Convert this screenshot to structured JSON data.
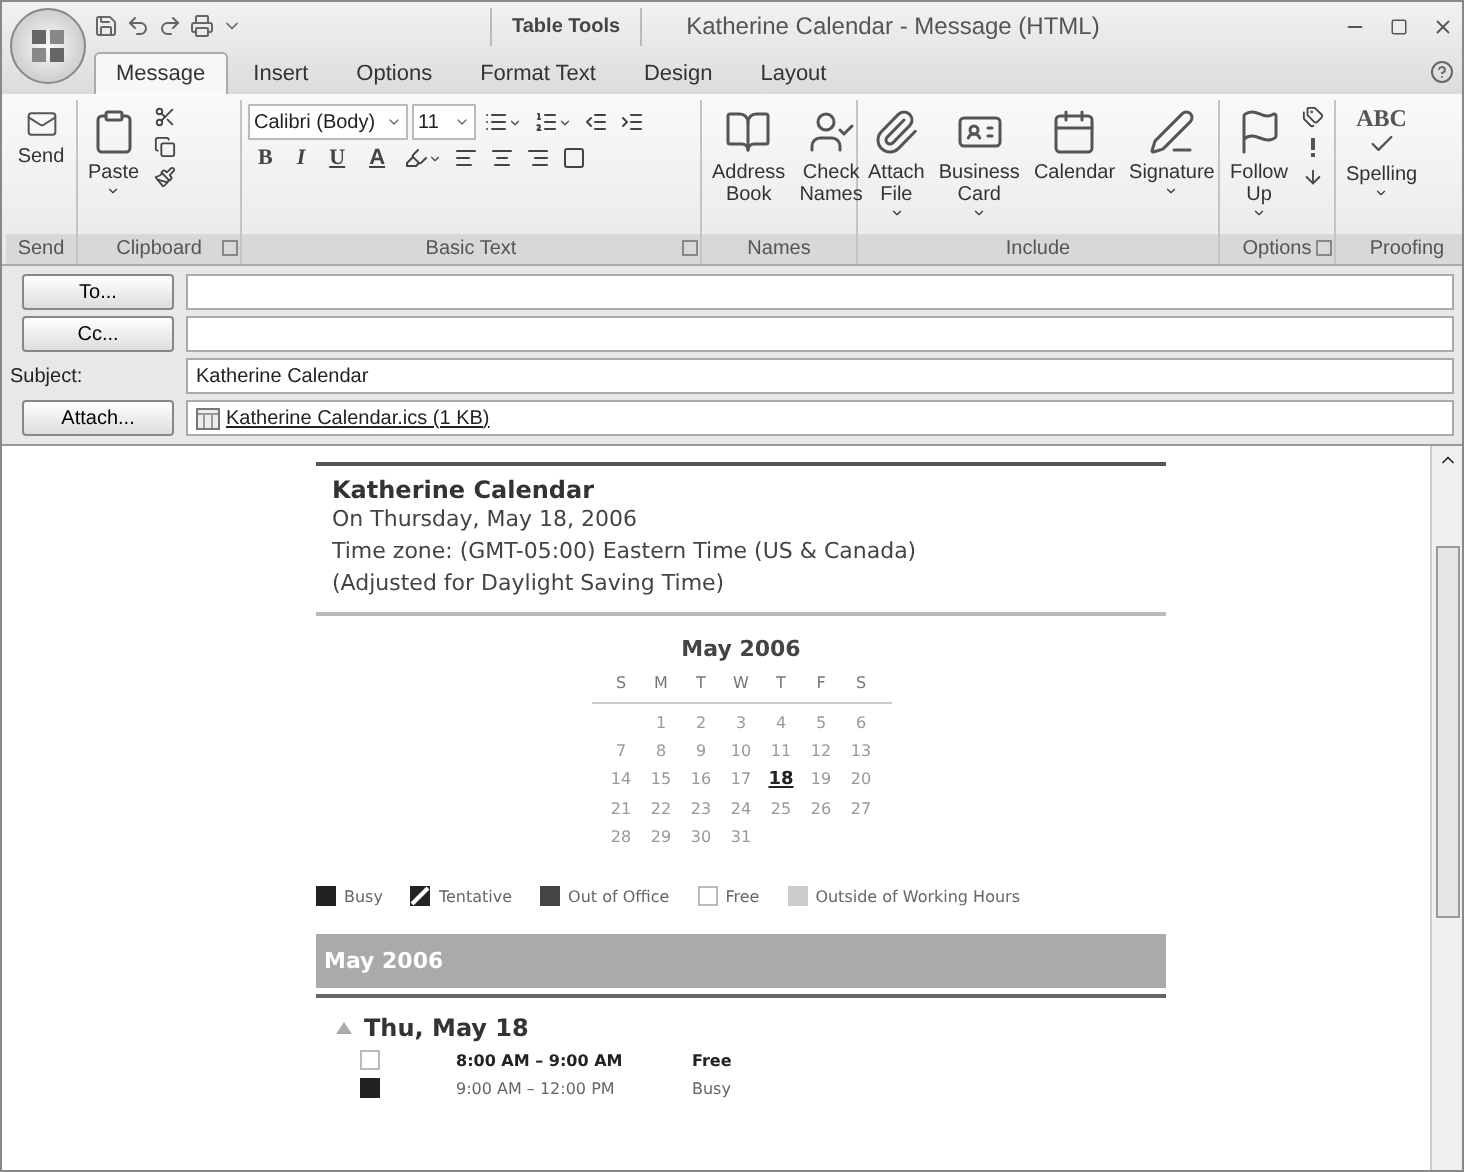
{
  "window": {
    "title": "Katherine Calendar - Message (HTML)",
    "contextual_label": "Table Tools"
  },
  "tabs": [
    {
      "label": "Message",
      "selected": true
    },
    {
      "label": "Insert",
      "selected": false
    },
    {
      "label": "Options",
      "selected": false
    },
    {
      "label": "Format Text",
      "selected": false
    },
    {
      "label": "Design",
      "selected": false
    },
    {
      "label": "Layout",
      "selected": false
    }
  ],
  "ribbon": {
    "groups": [
      {
        "kind": "send",
        "label": "Send",
        "launcher": false,
        "buttons": [
          {
            "label": "Send",
            "dropdown": false
          }
        ]
      },
      {
        "kind": "clipboard",
        "label": "Clipboard",
        "launcher": true,
        "buttons": [
          {
            "label": "Paste",
            "dropdown": true
          }
        ]
      },
      {
        "kind": "basic_text",
        "label": "Basic Text",
        "launcher": true,
        "font": "Calibri (Body)",
        "size": "11",
        "format_keys": [
          "B",
          "I",
          "U"
        ],
        "color_key": "A"
      },
      {
        "kind": "names",
        "label": "Names",
        "launcher": false,
        "buttons": [
          {
            "label": "Address Book",
            "dropdown": false
          },
          {
            "label": "Check Names",
            "dropdown": false
          }
        ]
      },
      {
        "kind": "include",
        "label": "Include",
        "launcher": false,
        "buttons": [
          {
            "label": "Attach File",
            "dropdown": true
          },
          {
            "label": "Business Card",
            "dropdown": true
          },
          {
            "label": "Calendar",
            "dropdown": false
          },
          {
            "label": "Signature",
            "dropdown": true
          }
        ]
      },
      {
        "kind": "options",
        "label": "Options",
        "launcher": true,
        "buttons": [
          {
            "label": "Follow Up",
            "dropdown": true
          }
        ]
      },
      {
        "kind": "proofing",
        "label": "Proofing",
        "launcher": false,
        "glyph": "ABC",
        "buttons": [
          {
            "label": "Spelling",
            "dropdown": true
          }
        ]
      }
    ]
  },
  "form": {
    "to": {
      "label": "To..."
    },
    "cc": {
      "label": "Cc..."
    },
    "subject": {
      "label": "Subject:",
      "value": "Katherine Calendar"
    },
    "attach": {
      "label": "Attach...",
      "file": "Katherine Calendar.ics (1 KB)"
    }
  },
  "body": {
    "title": "Katherine Calendar",
    "lines": [
      "On Thursday, May 18, 2006",
      "Time zone: (GMT-05:00) Eastern Time (US & Canada)",
      "(Adjusted for Daylight Saving Time)"
    ],
    "calendar": {
      "month": "May 2006",
      "weekdays": [
        "S",
        "M",
        "T",
        "W",
        "T",
        "F",
        "S"
      ],
      "weeks": [
        [
          {
            "day": "1",
            "selected": false
          },
          {
            "day": "2",
            "selected": false
          },
          {
            "day": "3",
            "selected": false
          },
          {
            "day": "4",
            "selected": false
          },
          {
            "day": "5",
            "selected": false
          },
          {
            "day": "6",
            "selected": false
          }
        ],
        [
          {
            "day": "7",
            "selected": false
          },
          {
            "day": "8",
            "selected": false
          },
          {
            "day": "9",
            "selected": false
          },
          {
            "day": "10",
            "selected": false
          },
          {
            "day": "11",
            "selected": false
          },
          {
            "day": "12",
            "selected": false
          },
          {
            "day": "13",
            "selected": false
          }
        ],
        [
          {
            "day": "14",
            "selected": false
          },
          {
            "day": "15",
            "selected": false
          },
          {
            "day": "16",
            "selected": false
          },
          {
            "day": "17",
            "selected": false
          },
          {
            "day": "18",
            "selected": true
          },
          {
            "day": "19",
            "selected": false
          },
          {
            "day": "20",
            "selected": false
          }
        ],
        [
          {
            "day": "21",
            "selected": false
          },
          {
            "day": "22",
            "selected": false
          },
          {
            "day": "23",
            "selected": false
          },
          {
            "day": "24",
            "selected": false
          },
          {
            "day": "25",
            "selected": false
          },
          {
            "day": "26",
            "selected": false
          },
          {
            "day": "27",
            "selected": false
          }
        ],
        [
          {
            "day": "28",
            "selected": false
          },
          {
            "day": "29",
            "selected": false
          },
          {
            "day": "30",
            "selected": false
          },
          {
            "day": "31",
            "selected": false
          }
        ]
      ]
    },
    "legend": [
      {
        "kind": "busy",
        "label": "Busy"
      },
      {
        "kind": "tentative",
        "label": "Tentative"
      },
      {
        "kind": "out_of_office",
        "label": "Out of Office"
      },
      {
        "kind": "free",
        "label": "Free"
      },
      {
        "kind": "outside",
        "label": "Outside of Working Hours"
      }
    ],
    "month_band": "May 2006",
    "day": {
      "label": "Thu, May 18",
      "expanded": true,
      "events": [
        {
          "kind": "free",
          "time": "8:00 AM – 9:00 AM",
          "status": "Free",
          "highlighted": true
        },
        {
          "kind": "busy",
          "time": "9:00 AM – 12:00 PM",
          "status": "Busy",
          "highlighted": false
        }
      ]
    }
  }
}
